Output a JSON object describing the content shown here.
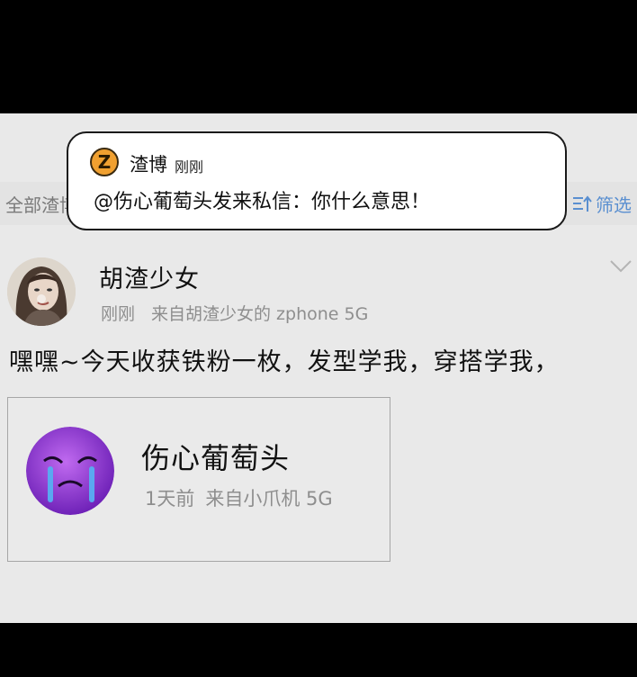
{
  "filter_bar": {
    "left_label": "全部渣博",
    "right_label": "筛选",
    "right_color": "#5a8fd0",
    "icon": "filter-sort-icon"
  },
  "notification": {
    "logo_letter": "Z",
    "logo_color": "#f0a030",
    "sender": "渣博",
    "time": "刚刚",
    "message": "@伤心葡萄头发来私信：你什么意思！"
  },
  "post": {
    "author": "胡渣少女",
    "time": "刚刚",
    "source": "来自胡渣少女的 zphone 5G",
    "body": "嘿嘿~今天收获铁粉一枚，发型学我，穿搭学我，",
    "avatar_icon": "woman-portrait-avatar",
    "expand_icon": "chevron-down-icon"
  },
  "quoted_user": {
    "name": "伤心葡萄头",
    "time": "1天前",
    "source": "来自小爪机 5G",
    "avatar_icon": "crying-grape-avatar",
    "avatar_color": "#9b3fe0"
  }
}
